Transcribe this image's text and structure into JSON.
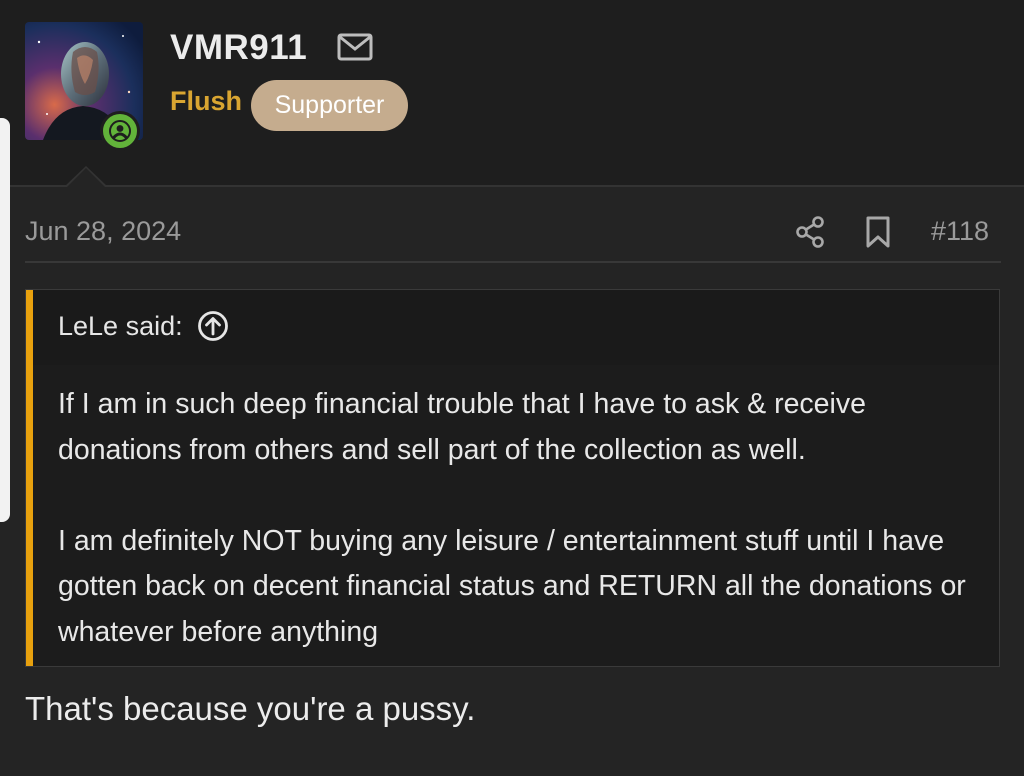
{
  "user": {
    "name": "VMR911",
    "title": "Flush",
    "badge": "Supporter",
    "online_icon": "user-online-icon",
    "message_icon": "envelope-icon"
  },
  "post": {
    "date": "Jun 28, 2024",
    "number": "#118",
    "actions": [
      "share-icon",
      "bookmark-icon"
    ]
  },
  "quote": {
    "author": "LeLe said:",
    "jump_icon": "arrow-up-circle-icon",
    "paragraphs": [
      "If I am in such deep financial trouble that I have to ask & receive donations from others and sell part of the collection as well.",
      "I am definitely NOT buying any leisure / entertainment stuff until I have gotten back on decent financial status and RETURN all the donations or whatever before anything"
    ]
  },
  "reply": {
    "text": "That's because you're a pussy."
  },
  "colors": {
    "background": "#242424",
    "header": "#1e1e1e",
    "user_title": "#d9a531",
    "badge": "#c5ac8e",
    "quote_accent": "#e8a10e",
    "online": "#62b33a"
  }
}
